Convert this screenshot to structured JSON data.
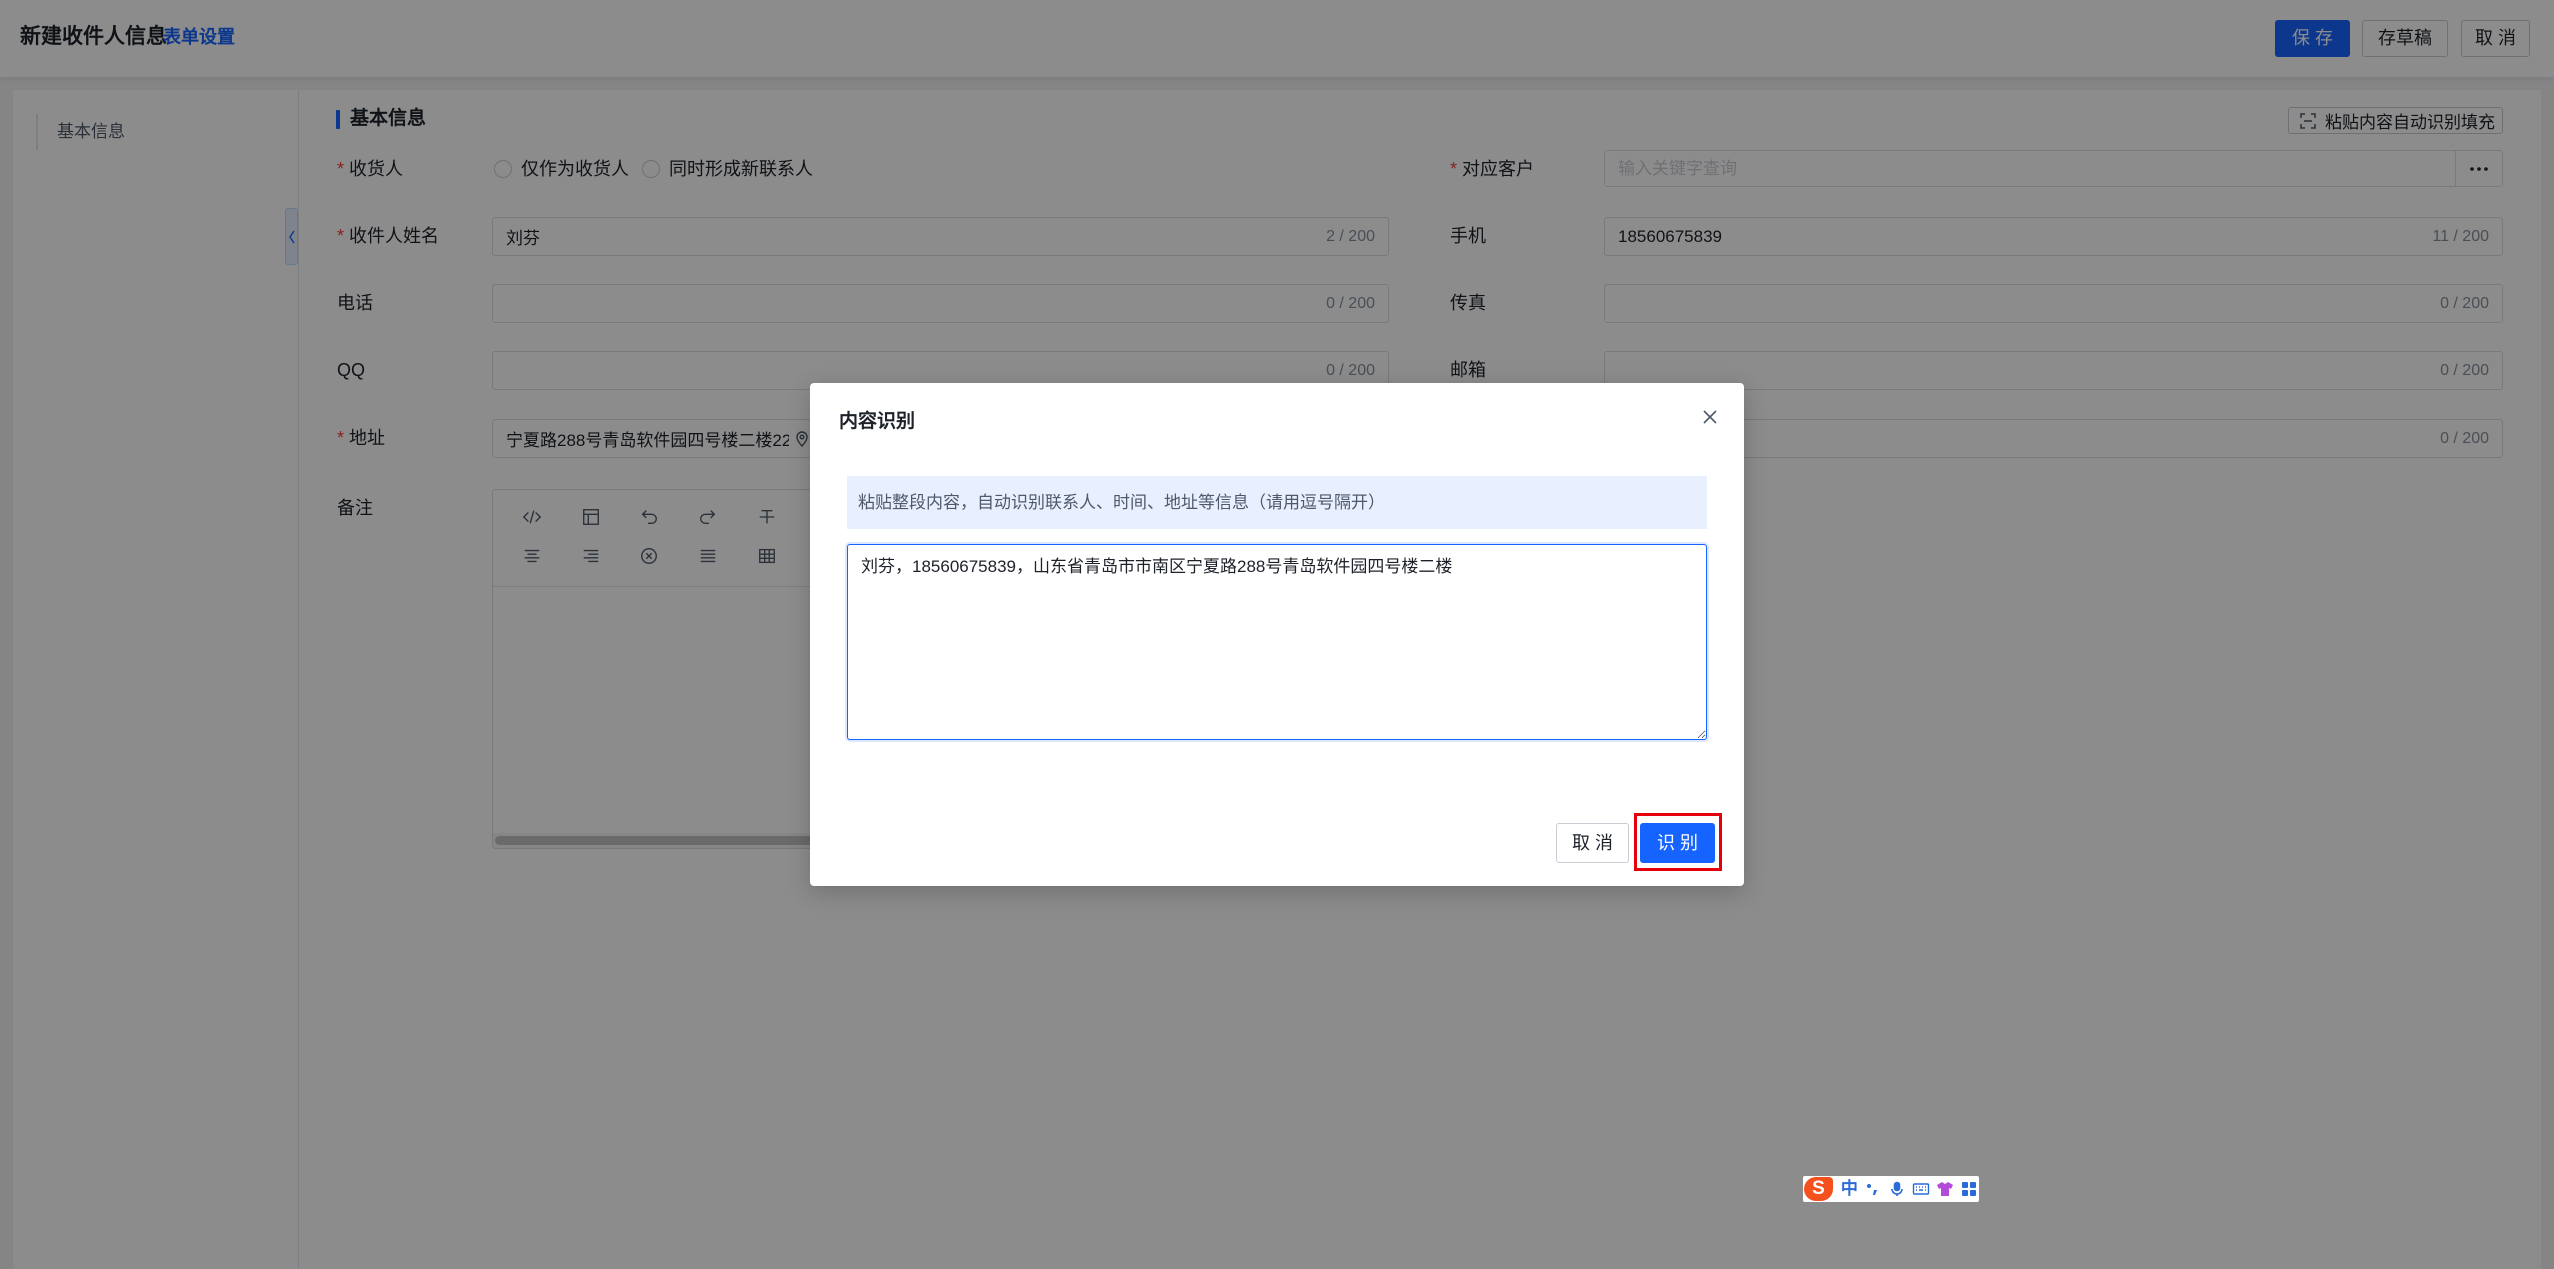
{
  "header": {
    "title": "新建收件人信息",
    "form_settings_link": "表单设置",
    "save_label": "保存",
    "draft_label": "存草稿",
    "cancel_label": "取消"
  },
  "sidebar": {
    "items": [
      {
        "label": "基本信息",
        "active": true
      }
    ],
    "collapse_icon": "chevron-left-icon"
  },
  "section": {
    "title": "基本信息",
    "paste_button_label": "粘贴内容自动识别填充",
    "paste_button_icon": "scan-icon"
  },
  "form": {
    "required_mark": "*",
    "consignee": {
      "label": "收货人",
      "required": true,
      "options": [
        {
          "label": "仅作为收货人",
          "checked": false
        },
        {
          "label": "同时形成新联系人",
          "checked": false
        }
      ]
    },
    "customer": {
      "label": "对应客户",
      "required": true,
      "value": "",
      "placeholder": "输入关键字查询",
      "more_icon": "more-icon"
    },
    "recipient_name": {
      "label": "收件人姓名",
      "required": true,
      "value": "刘芬",
      "counter": "2 / 200"
    },
    "mobile": {
      "label": "手机",
      "value": "18560675839",
      "counter": "11 / 200"
    },
    "phone": {
      "label": "电话",
      "value": "",
      "counter": "0 / 200"
    },
    "fax": {
      "label": "传真",
      "value": "",
      "counter": "0 / 200"
    },
    "qq": {
      "label": "QQ",
      "value": "",
      "counter": "0 / 200"
    },
    "email": {
      "label": "邮箱",
      "value": "",
      "counter": "0 / 200"
    },
    "address": {
      "label": "地址",
      "required": true,
      "value": "宁夏路288号青岛软件园四号楼二楼22",
      "icon": "location-icon"
    },
    "address_extra": {
      "value": "",
      "counter": "0 / 200"
    },
    "remark": {
      "label": "备注",
      "toolbar_icons": [
        "code-icon",
        "template-icon",
        "undo-icon",
        "redo-icon",
        "strikethrough-icon",
        "align-center-icon",
        "align-right-icon",
        "clear-format-icon",
        "justify-icon",
        "table-icon"
      ]
    }
  },
  "modal": {
    "title": "内容识别",
    "close_icon": "close-icon",
    "hint": "粘贴整段内容，自动识别联系人、时间、地址等信息（请用逗号隔开）",
    "textarea_value": "刘芬，18560675839，山东省青岛市市南区宁夏路288号青岛软件园四号楼二楼",
    "cancel_label": "取消",
    "recognize_label": "识别"
  },
  "ime": {
    "logo_letter": "S",
    "lang_label": "中",
    "icons": [
      "punctuation-icon",
      "microphone-icon",
      "keyboard-icon",
      "skin-icon",
      "toolbox-icon"
    ]
  },
  "colors": {
    "primary": "#1664ff",
    "required": "#f53f3f",
    "highlight_box": "#e5000c",
    "hint_background": "#e8f0ff",
    "ime_logo": "#f4511e"
  }
}
